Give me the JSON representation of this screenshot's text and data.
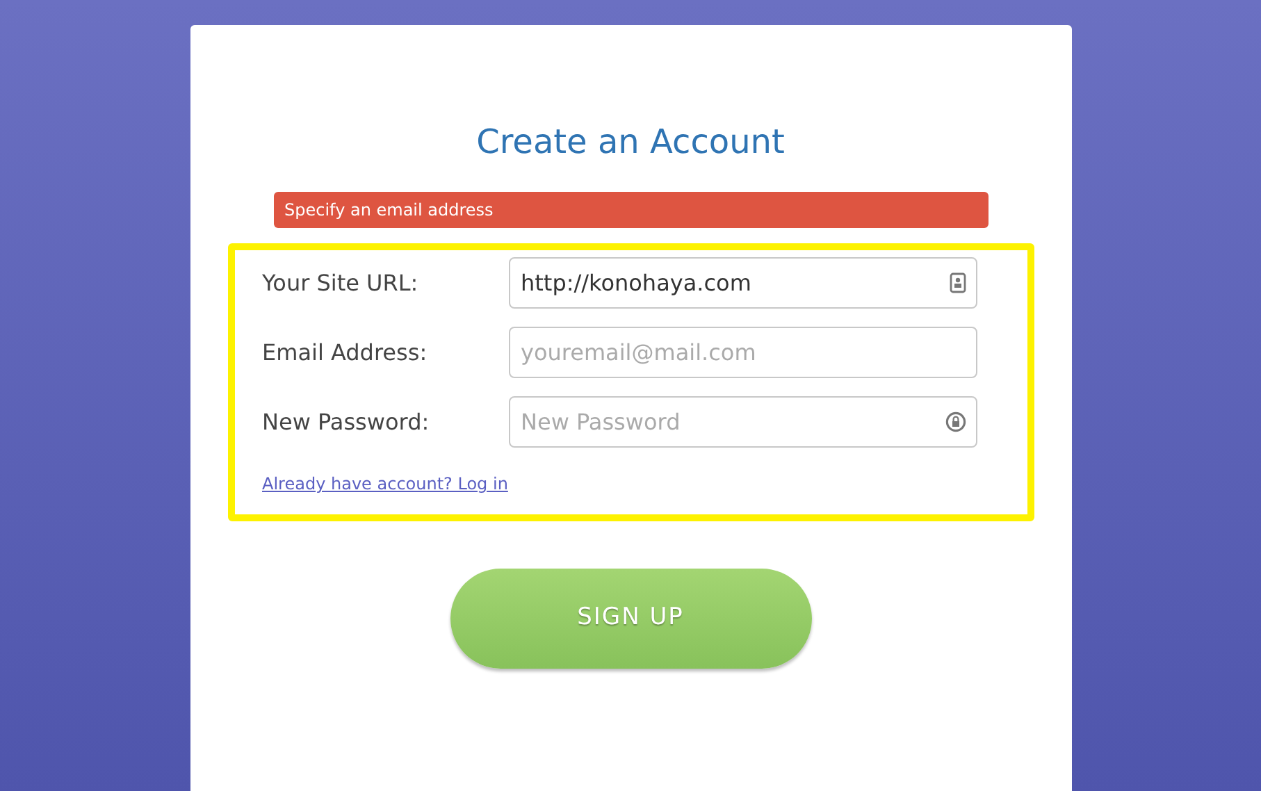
{
  "title": "Create an Account",
  "error": "Specify an email address",
  "fields": [
    {
      "kind": "url",
      "label": "Your Site URL:",
      "value": "http://konohaya.com"
    },
    {
      "kind": "email",
      "label": "Email Address:",
      "placeholder": "youremail@mail.com"
    },
    {
      "kind": "password",
      "label": "New Password:",
      "placeholder": "New Password"
    }
  ],
  "login_link": "Already have account? Log in",
  "submit": "SIGN UP"
}
